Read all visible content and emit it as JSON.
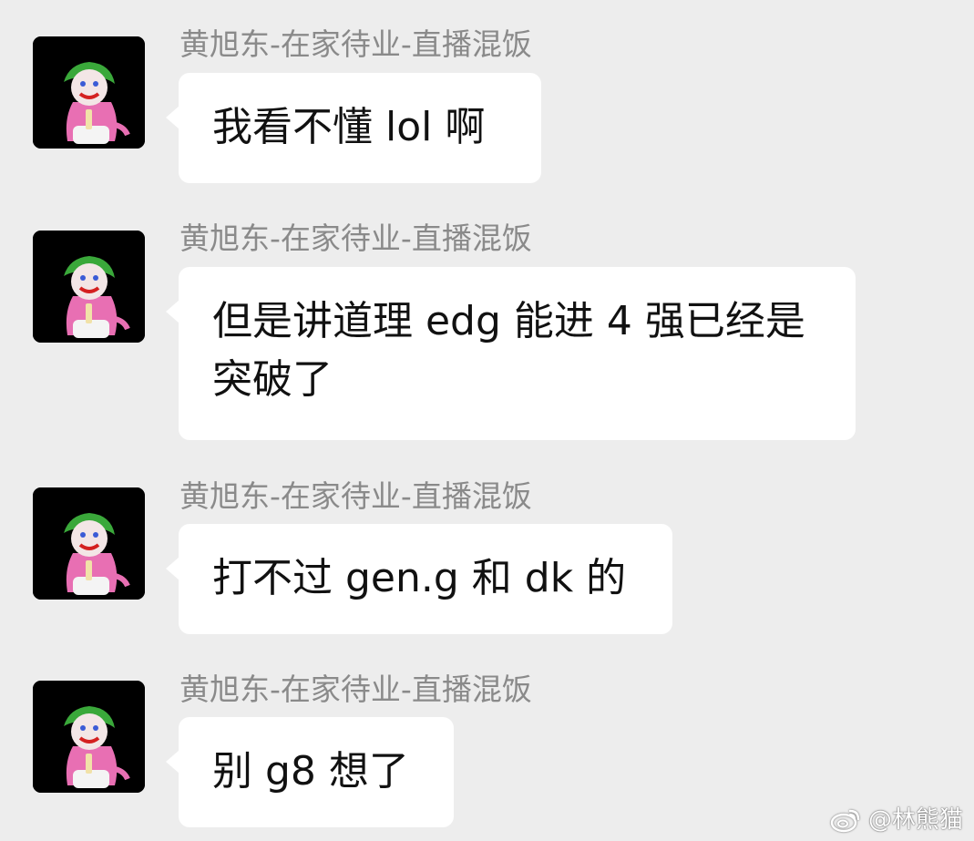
{
  "messages": [
    {
      "sender": "黄旭东-在家待业-直播混饭",
      "text": "我看不懂 lol 啊"
    },
    {
      "sender": "黄旭东-在家待业-直播混饭",
      "text": "但是讲道理 edg 能进 4 强已经是突破了"
    },
    {
      "sender": "黄旭东-在家待业-直播混饭",
      "text": "打不过 gen.g 和 dk 的"
    },
    {
      "sender": "黄旭东-在家待业-直播混饭",
      "text": "别 g8 想了"
    }
  ],
  "watermark": {
    "text": "@林熊猫",
    "icon": "weibo-logo"
  },
  "colors": {
    "background": "#ededed",
    "bubble": "#ffffff",
    "sender_text": "#8a8a8a",
    "message_text": "#111111",
    "avatar_bg": "#000000"
  }
}
